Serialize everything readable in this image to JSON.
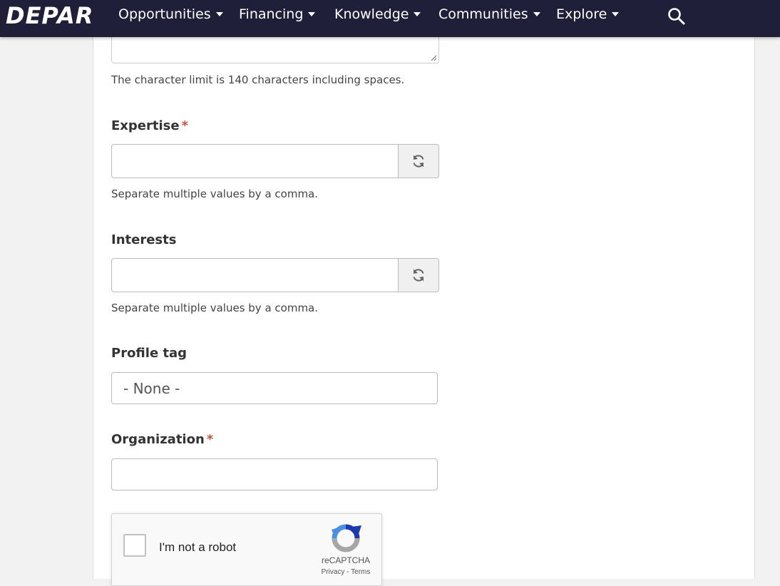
{
  "brand": {
    "logo_text": "DEPAR"
  },
  "nav": {
    "items": [
      {
        "label": "Opportunities"
      },
      {
        "label": "Financing"
      },
      {
        "label": "Knowledge"
      },
      {
        "label": "Communities"
      },
      {
        "label": "Explore"
      }
    ],
    "search_icon": "search-icon"
  },
  "form": {
    "bio_help": "The character limit is 140 characters including spaces.",
    "expertise": {
      "label": "Expertise",
      "required_mark": "*",
      "value": "",
      "help": "Separate multiple values by a comma.",
      "addon_icon": "refresh-icon"
    },
    "interests": {
      "label": "Interests",
      "value": "",
      "help": "Separate multiple values by a comma.",
      "addon_icon": "refresh-icon"
    },
    "profile_tag": {
      "label": "Profile tag",
      "selected": "- None -"
    },
    "organization": {
      "label": "Organization",
      "required_mark": "*",
      "value": ""
    }
  },
  "recaptcha": {
    "label": "I'm not a robot",
    "brand": "reCAPTCHA",
    "privacy": "Privacy",
    "separator": "-",
    "terms": "Terms",
    "colors": {
      "blue": "#1c3aa9",
      "light_blue": "#4a90e2",
      "gray": "#a6a6a6"
    }
  },
  "colors": {
    "navbar": "#1f1f3a",
    "required": "#c0583a",
    "page_bg": "#f2f2f2"
  }
}
